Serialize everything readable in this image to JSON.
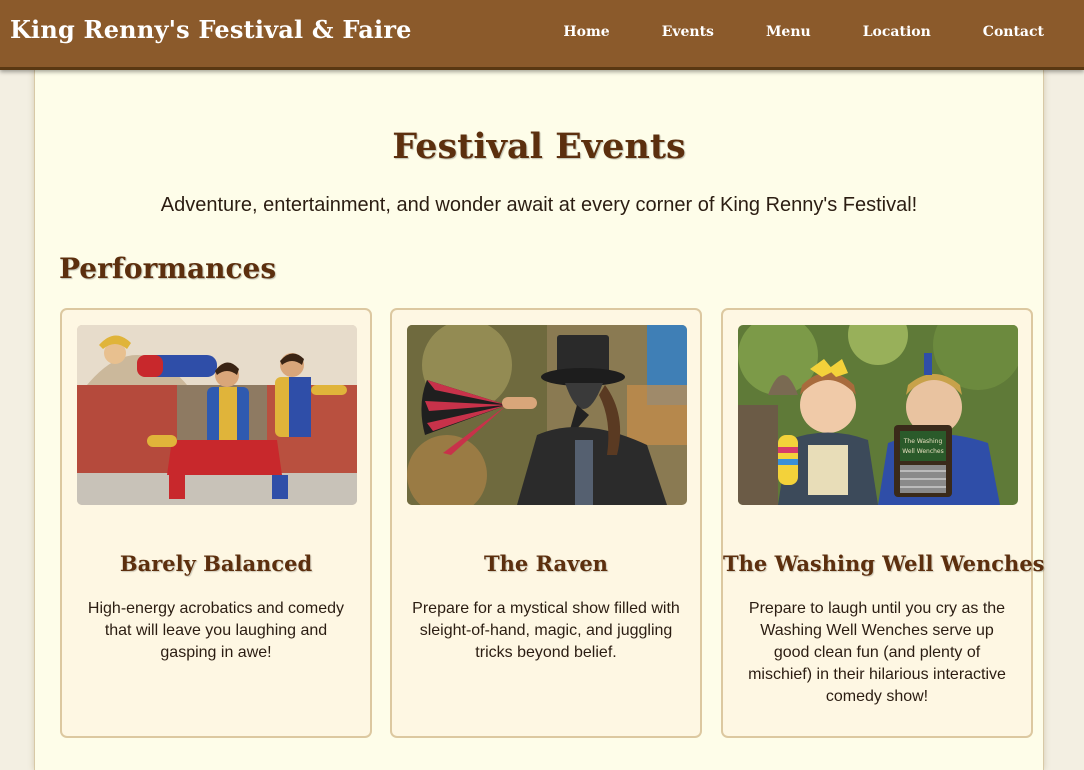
{
  "header": {
    "site_title": "King Renny's Festival & Faire",
    "nav": [
      "Home",
      "Events",
      "Menu",
      "Location",
      "Contact"
    ]
  },
  "main": {
    "title": "Festival Events",
    "subtitle": "Adventure, entertainment, and wonder await at every corner of King Renny's Festival!",
    "section_heading": "Performances",
    "cards": [
      {
        "title": "Barely Balanced",
        "description": "High-energy acrobatics and comedy that will leave you laughing and gasping in awe!"
      },
      {
        "title": "The Raven",
        "description": "Prepare for a mystical show filled with sleight-of-hand, magic, and juggling tricks beyond belief."
      },
      {
        "title": "The Washing Well Wenches",
        "description": "Prepare to laugh until you cry as the Washing Well Wenches serve up good clean fun (and plenty of mischief) in their hilarious interactive comedy show!",
        "image_sign_text": "The Washing Well Wenches"
      }
    ]
  },
  "colors": {
    "header_bg": "#8b5a2b",
    "heading": "#5c2f0e",
    "panel_bg": "#fefde9",
    "card_bg": "#fef7e3",
    "card_border": "#dcc8a0"
  }
}
